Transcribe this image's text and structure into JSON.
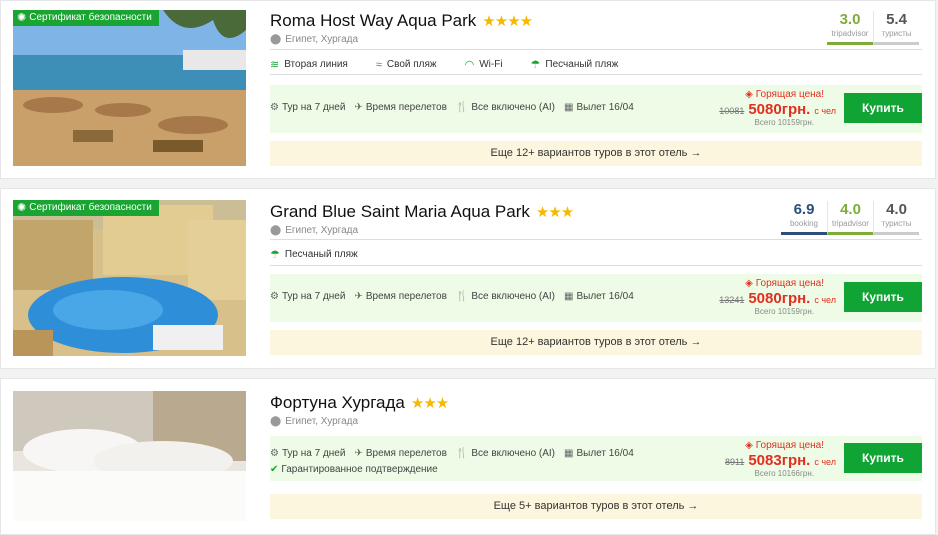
{
  "hotels": [
    {
      "badge": "Сертификат безопасности",
      "name": "Roma Host Way Aqua Park",
      "stars": "★★★★",
      "location": "Египет, Хургада",
      "ratings": [
        {
          "value": "3.0",
          "source": "tripadvisor"
        },
        {
          "value": "5.4",
          "source": "туристы"
        }
      ],
      "features": [
        "Вторая линия",
        "Свой пляж",
        "Wi-Fi",
        "Песчаный пляж"
      ],
      "tour": "Тур на 7 дней",
      "flight": "Время перелетов",
      "meal": "Все включено (AI)",
      "departure": "Вылет 16/04",
      "hot_label": "Горящая цена!",
      "old_price": "10081",
      "price": "5080грн.",
      "per": "с чел",
      "total": "Всего 10159грн.",
      "buy": "Купить",
      "more": "Еще 12+ вариантов туров в этот отель →"
    },
    {
      "badge": "Сертификат безопасности",
      "name": "Grand Blue Saint Maria Aqua Park",
      "stars": "★★★",
      "location": "Египет, Хургада",
      "ratings": [
        {
          "value": "6.9",
          "source": "booking"
        },
        {
          "value": "4.0",
          "source": "tripadvisor"
        },
        {
          "value": "4.0",
          "source": "туристы"
        }
      ],
      "features": [
        "Песчаный пляж"
      ],
      "tour": "Тур на 7 дней",
      "flight": "Время перелетов",
      "meal": "Все включено (AI)",
      "departure": "Вылет 16/04",
      "hot_label": "Горящая цена!",
      "old_price": "13241",
      "price": "5080грн.",
      "per": "с чел",
      "total": "Всего 10159грн.",
      "buy": "Купить",
      "more": "Еще 12+ вариантов туров в этот отель →"
    },
    {
      "name": "Фортуна Хургада",
      "stars": "★★★",
      "location": "Египет, Хургада",
      "tour": "Тур на 7 дней",
      "flight": "Время перелетов",
      "meal": "Все включено (AI)",
      "departure": "Вылет 16/04",
      "guarantee": "Гарантированное подтверждение",
      "hot_label": "Горящая цена!",
      "old_price": "8911",
      "price": "5083грн.",
      "per": "с чел",
      "total": "Всего 10166грн.",
      "buy": "Купить",
      "more": "Еще 5+ вариантов туров в этот отель →"
    }
  ],
  "colors": {
    "accent_green": "#10a434",
    "hot_red": "#e1301f",
    "star_gold": "#f6b800",
    "offer_bg": "#eefbe6",
    "more_bg": "#fbf6dd"
  }
}
